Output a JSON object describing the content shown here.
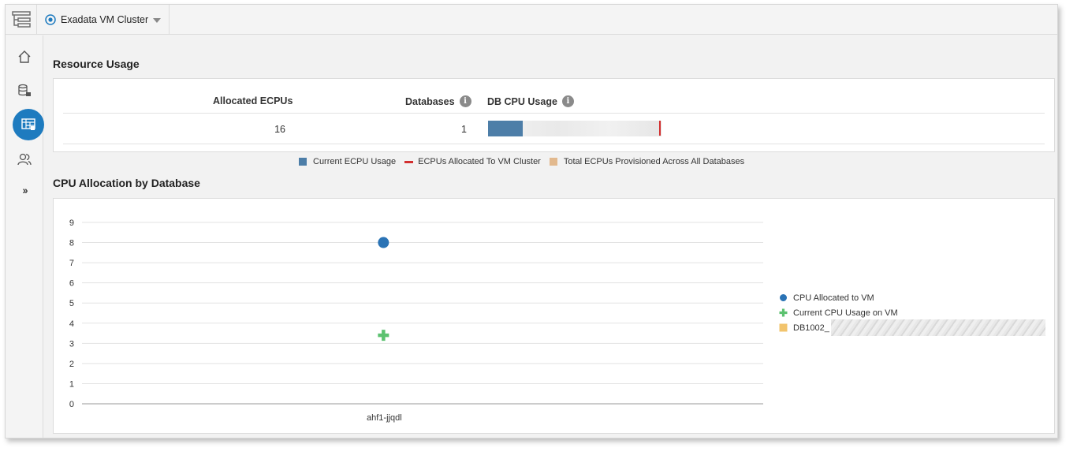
{
  "topbar": {
    "target_label": "Exadata VM Cluster"
  },
  "icons": {
    "menu": "tree-menu-icon",
    "target": "target-radio-icon",
    "home": "home-icon",
    "databases": "database-icon",
    "cluster": "vm-cluster-icon",
    "users": "users-icon",
    "expand": "double-chevron-right-icon"
  },
  "rail": {
    "expand_label": "››"
  },
  "resource_usage": {
    "title": "Resource Usage",
    "columns": {
      "allocated_ecpus": "Allocated ECPUs",
      "databases": "Databases",
      "db_cpu_usage": "DB CPU Usage"
    },
    "info_glyph": "i",
    "values": {
      "allocated_ecpus": "16",
      "databases": "1"
    },
    "db_cpu_bar": {
      "current_ecpu_usage_fraction": 0.2,
      "allocated_marker_fraction": 0.99
    },
    "legend": [
      {
        "label": "Current ECPU Usage",
        "color": "#4d7ea8",
        "shape": "square"
      },
      {
        "label": "ECPUs Allocated To VM Cluster",
        "color": "#d22f2f",
        "shape": "line"
      },
      {
        "label": "Total ECPUs Provisioned Across All Databases",
        "color": "#e2b98e",
        "shape": "square"
      }
    ]
  },
  "cpu_allocation": {
    "title": "CPU Allocation by Database"
  },
  "colors": {
    "accent": "#1e7bbf",
    "alloc_point": "#2a73b5",
    "usage_point": "#5cc270",
    "db_series": "#f2c46d"
  },
  "chart_data": {
    "type": "scatter",
    "title": "CPU Allocation by Database",
    "xlabel": "",
    "ylabel": "",
    "categories": [
      "ahf1-jjqdl"
    ],
    "ylim": [
      0,
      9
    ],
    "yticks": [
      0,
      1,
      2,
      3,
      4,
      5,
      6,
      7,
      8,
      9
    ],
    "grid": true,
    "legend_position": "right",
    "series": [
      {
        "name": "CPU Allocated to VM",
        "marker": "circle",
        "color": "#2a73b5",
        "values": [
          8
        ]
      },
      {
        "name": "Current CPU Usage on VM",
        "marker": "plus",
        "color": "#5cc270",
        "values": [
          3.4
        ]
      },
      {
        "name": "DB1002_",
        "marker": "square",
        "color": "#f2c46d",
        "values": []
      }
    ]
  }
}
